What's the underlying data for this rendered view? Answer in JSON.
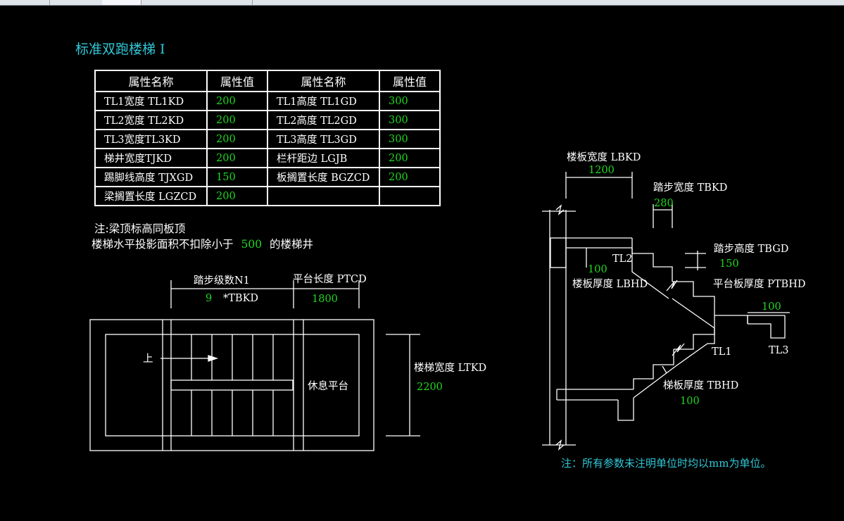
{
  "title": "标准双跑楼梯 I",
  "table": {
    "headers": [
      "属性名称",
      "属性值",
      "属性名称",
      "属性值"
    ],
    "rows": [
      [
        "TL1宽度 TL1KD",
        "200",
        "TL1高度 TL1GD",
        "300"
      ],
      [
        "TL2宽度 TL2KD",
        "200",
        "TL2高度 TL2GD",
        "300"
      ],
      [
        "TL3宽度TL3KD",
        "200",
        "TL3高度 TL3GD",
        "300"
      ],
      [
        "梯井宽度TJKD",
        "200",
        "栏杆距边 LGJB",
        "200"
      ],
      [
        "踢脚线高度 TJXGD",
        "150",
        "板搁置长度 BGZCD",
        "200"
      ],
      [
        "梁搁置长度 LGZCD",
        "200",
        "",
        ""
      ]
    ]
  },
  "notes": {
    "line1": "注:梁顶标高同板顶",
    "line2_prefix": "楼梯水平投影面积不扣除小于",
    "line2_value": "500",
    "line2_suffix": "的楼梯井"
  },
  "plan": {
    "steps_label": "踏步级数N1",
    "steps_value": "9",
    "steps_unit": "*TBKD",
    "platform_label": "平台长度 PTCD",
    "platform_value": "1800",
    "up_label": "上",
    "rest_label": "休息平台",
    "width_label": "楼梯宽度 LTKD",
    "width_value": "2200"
  },
  "section": {
    "slab_width_label": "楼板宽度 LBKD",
    "slab_width_value": "1200",
    "tread_width_label": "踏步宽度 TBKD",
    "tread_width_value": "280",
    "tread_height_label": "踏步高度 TBGD",
    "tread_height_value": "150",
    "floor_thk_label": "楼板厚度 LBHD",
    "floor_thk_value": "100",
    "platform_thk_label": "平台板厚度 PTBHD",
    "platform_thk_value": "100",
    "stair_thk_label": "梯板厚度 TBHD",
    "stair_thk_value": "100",
    "tl1": "TL1",
    "tl2": "TL2",
    "tl3": "TL3"
  },
  "footnote": "注：所有参数未注明单位时均以mm为单位。",
  "colors": {
    "background": "#000000",
    "lines": "#ffffff",
    "values": "#1fd81f",
    "cyan": "#31c7d6"
  }
}
